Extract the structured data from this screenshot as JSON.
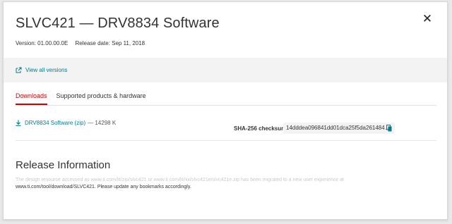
{
  "header": {
    "title": "SLVC421 — DRV8834 Software",
    "close_glyph": "✕",
    "version": "Version: 01.00.00.0E",
    "release_date": "Release date: Sep 11, 2018"
  },
  "versions": {
    "link_label": "View all versions",
    "icon": "external-link-icon"
  },
  "tabs": [
    {
      "label": "Downloads",
      "active": true
    },
    {
      "label": "Supported products & hardware",
      "active": false
    }
  ],
  "downloads": [
    {
      "label": "DRV8834 Software (zip)",
      "size": "— 14298 K",
      "checksum_label": "SHA-256 checksum",
      "checksum_value": "14dddea096841dd01dca25f5da261484…"
    }
  ],
  "release_info": {
    "title": "Release Information",
    "line1": "The design resource accessed as www.ti.com/lit/zip/slvc421 or www.ti.com/lit/xx/slvc421e/slvc421e.zip has been migrated to a new user experience at",
    "line2": "www.ti.com/tool/download/SLVC421. Please update any bookmarks accordingly."
  },
  "colors": {
    "accent": "#007c8c",
    "active_tab": "#cc0000",
    "band": "#f3f3f3"
  }
}
